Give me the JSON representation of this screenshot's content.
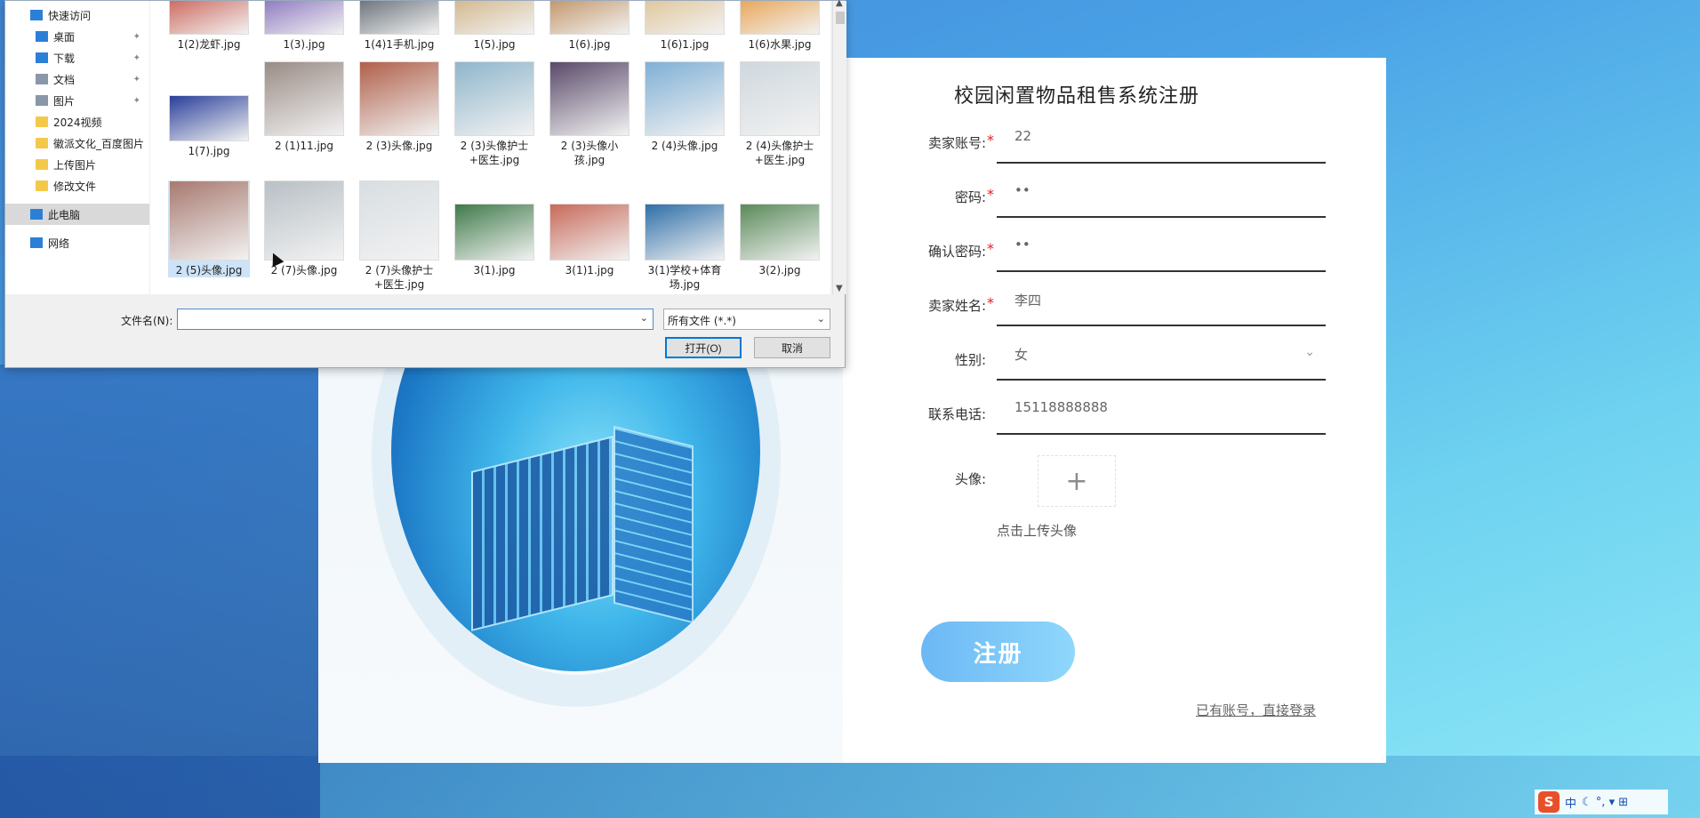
{
  "dialog": {
    "nav": [
      {
        "label": "快速访问",
        "icon": "star-icon",
        "pinned": false
      },
      {
        "label": "桌面",
        "icon": "desktop-icon",
        "pinned": true
      },
      {
        "label": "下载",
        "icon": "download-icon",
        "pinned": true
      },
      {
        "label": "文档",
        "icon": "document-icon",
        "pinned": true
      },
      {
        "label": "图片",
        "icon": "picture-icon",
        "pinned": true
      },
      {
        "label": "2024视频",
        "icon": "folder-icon",
        "pinned": false
      },
      {
        "label": "徽派文化_百度图片",
        "icon": "folder-icon",
        "pinned": false
      },
      {
        "label": "上传图片",
        "icon": "folder-icon",
        "pinned": false
      },
      {
        "label": "修改文件",
        "icon": "folder-icon",
        "pinned": false
      },
      {
        "label": "此电脑",
        "icon": "computer-icon",
        "pinned": false
      },
      {
        "label": "网络",
        "icon": "network-icon",
        "pinned": false
      }
    ],
    "files": [
      {
        "name": "1(2)龙虾.jpg",
        "color": "#c0392b"
      },
      {
        "name": "1(3).jpg",
        "color": "#6b4fb0"
      },
      {
        "name": "1(4)1手机.jpg",
        "color": "#3a4650"
      },
      {
        "name": "1(5).jpg",
        "color": "#c9a36b"
      },
      {
        "name": "1(6).jpg",
        "color": "#b0763a"
      },
      {
        "name": "1(6)1.jpg",
        "color": "#d9b77d"
      },
      {
        "name": "1(6)水果.jpg",
        "color": "#e58a1f"
      },
      {
        "name": "1(7).jpg",
        "color": "#2a3f9a"
      },
      {
        "name": "2 (1)11.jpg",
        "color": "#9a8c86"
      },
      {
        "name": "2 (3)头像.jpg",
        "color": "#b0604a"
      },
      {
        "name": "2 (3)头像护士+医生.jpg",
        "color": "#8fb6cc"
      },
      {
        "name": "2 (3)头像小孩.jpg",
        "color": "#5a4a6a"
      },
      {
        "name": "2 (4)头像.jpg",
        "color": "#7fb0d6"
      },
      {
        "name": "2 (4)头像护士+医生.jpg",
        "color": "#cfd8de"
      },
      {
        "name": "2 (5)头像.jpg",
        "color": "#a87a70"
      },
      {
        "name": "2 (7)头像.jpg",
        "color": "#b8c0c6"
      },
      {
        "name": "2 (7)头像护士+医生.jpg",
        "color": "#d8dee2"
      },
      {
        "name": "3(1).jpg",
        "color": "#3f7a4a"
      },
      {
        "name": "3(1)1.jpg",
        "color": "#c86a5a"
      },
      {
        "name": "3(1)学校+体育场.jpg",
        "color": "#2f6fa8"
      },
      {
        "name": "3(2).jpg",
        "color": "#5a8a5a"
      }
    ],
    "filename_label": "文件名(N):",
    "filename_value": "",
    "filetype": "所有文件 (*.*)",
    "open_label": "打开(O)",
    "cancel_label": "取消"
  },
  "form": {
    "title": "校园闲置物品租售系统注册",
    "fields": [
      {
        "label": "卖家账号:",
        "value": "22",
        "required": true
      },
      {
        "label": "密码:",
        "value": "••",
        "required": true
      },
      {
        "label": "确认密码:",
        "value": "••",
        "required": true
      },
      {
        "label": "卖家姓名:",
        "value": "李四",
        "required": true
      },
      {
        "label": "性别:",
        "value": "女",
        "required": false
      },
      {
        "label": "联系电话:",
        "value": "15118888888",
        "required": false
      }
    ],
    "avatar_label": "头像:",
    "upload_plus": "+",
    "upload_tip": "点击上传头像",
    "register_label": "注册",
    "login_link": "已有账号，直接登录",
    "required_mark": "*"
  },
  "tray": {
    "ime_logo": "S",
    "ime_lang": "中",
    "ime_icons": "☾ °, ▾ ⊞"
  }
}
